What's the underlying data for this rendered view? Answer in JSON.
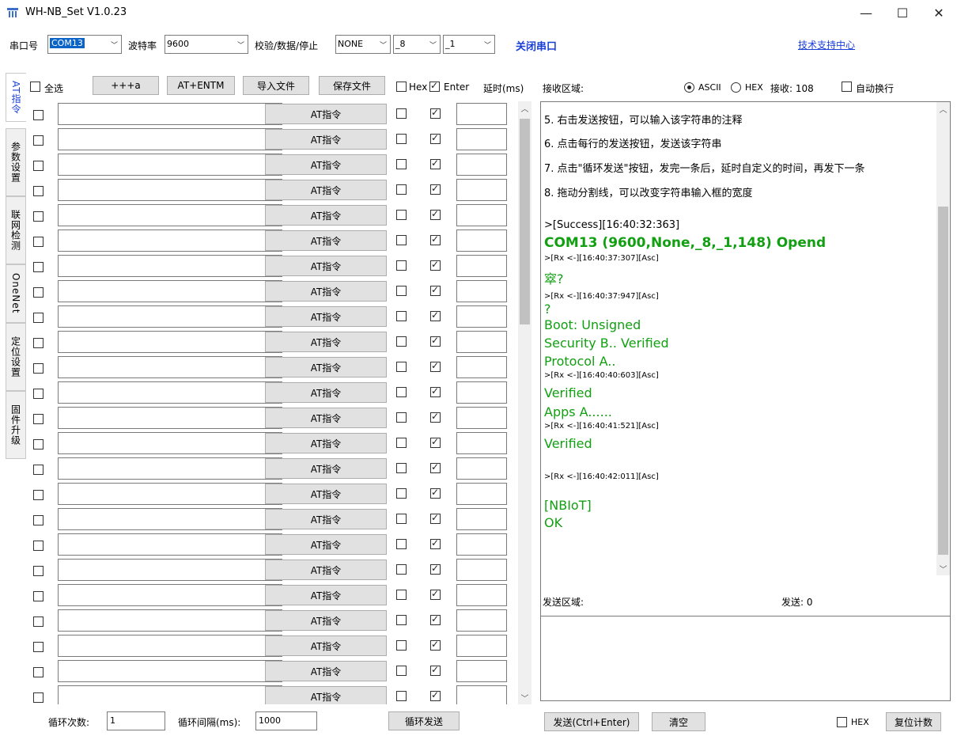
{
  "window": {
    "title": "WH-NB_Set V1.0.23",
    "min_glyph": "—",
    "max_glyph": "☐",
    "close_glyph": "✕"
  },
  "toolbar": {
    "port_label": "串口号",
    "port_value": "COM13",
    "baud_label": "波特率",
    "baud_value": "9600",
    "parity_label": "校验/数据/停止",
    "parity_value": "NONE",
    "data_bits": "_8",
    "stop_bits": "_1",
    "close_port": "关闭串口",
    "support_link": "技术支持中心"
  },
  "tabs": [
    {
      "label": "AT指令",
      "active": true
    },
    {
      "label": "参数设置",
      "active": false
    },
    {
      "label": "联网检测",
      "active": false
    },
    {
      "label": "OneNet",
      "active": false
    },
    {
      "label": "定位设置",
      "active": false
    },
    {
      "label": "固件升级",
      "active": false
    }
  ],
  "cmd_header": {
    "select_all": "全选",
    "btn_plus": "+++a",
    "btn_entm": "AT+ENTM",
    "btn_import": "导入文件",
    "btn_save": "保存文件",
    "hex": "Hex",
    "enter": "Enter",
    "delay": "延时(ms)"
  },
  "cmd_rows": {
    "count": 24,
    "button_label": "AT指令"
  },
  "bottom": {
    "loop_count_label": "循环次数:",
    "loop_count_value": "1",
    "interval_label": "循环间隔(ms):",
    "interval_value": "1000",
    "loop_send": "循环发送"
  },
  "receive": {
    "label": "接收区域:",
    "ascii": "ASCII",
    "hex": "HEX",
    "recv_label": "接收: 108",
    "auto_wrap": "自动换行",
    "lines": [
      "5. 右击发送按钮，可以输入该字符串的注释",
      "6. 点击每行的发送按钮，发送该字符串",
      "7. 点击\"循环发送\"按钮，发完一条后，延时自定义的时间，再发下一条",
      "8. 拖动分割线，可以改变字符串输入框的宽度",
      ">[Success][16:40:32:363]",
      "COM13 (9600,None,_8,_1,148) Opend",
      ">[Rx <-][16:40:37:307][Asc]",
      "窣?",
      ">[Rx <-][16:40:37:947][Asc]",
      "?",
      "Boot: Unsigned",
      "Security B.. Verified",
      "Protocol A..",
      ">[Rx <-][16:40:40:603][Asc]",
      "Verified",
      "Apps A......",
      ">[Rx <-][16:40:41:521][Asc]",
      "Verified",
      ">[Rx <-][16:40:42:011][Asc]",
      "[NBIoT]",
      "OK"
    ]
  },
  "send": {
    "label": "发送区域:",
    "count_label": "发送: 0",
    "send_btn": "发送(Ctrl+Enter)",
    "clear_btn": "清空",
    "hex": "HEX",
    "reset_btn": "复位计数"
  },
  "colors": {
    "accent_blue": "#1a3fd6",
    "green_text": "#12a012",
    "button_bg": "#e1e1e1"
  }
}
